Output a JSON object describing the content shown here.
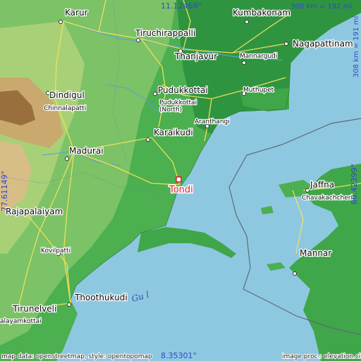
{
  "map": {
    "target_city": "Tondi",
    "cities": [
      {
        "id": "karur",
        "name": "Karur"
      },
      {
        "id": "kumbakonam",
        "name": "Kumbakonam"
      },
      {
        "id": "tiruchirappalli",
        "name": "Tiruchirappalli"
      },
      {
        "id": "thanjavur",
        "name": "Thanjavur"
      },
      {
        "id": "nagapattinam",
        "name": "Nagapattinam"
      },
      {
        "id": "mannargudi",
        "name": "Mannargudi"
      },
      {
        "id": "dindigul",
        "name": "Dindigul"
      },
      {
        "id": "chinnalapatti",
        "name": "Chinnalapatti"
      },
      {
        "id": "pudukkottai",
        "name": "Pudukkottai"
      },
      {
        "id": "pudukkottai-north",
        "name": "Pudukkottai\n(North)"
      },
      {
        "id": "muthupet",
        "name": "Muthupet"
      },
      {
        "id": "aranthangi",
        "name": "Aranthangi"
      },
      {
        "id": "karaikudi",
        "name": "Karaikudi"
      },
      {
        "id": "madurai",
        "name": "Madurai"
      },
      {
        "id": "jaffna",
        "name": "Jaffna"
      },
      {
        "id": "chavakachcheri",
        "name": "Chavakachcheri"
      },
      {
        "id": "rajapalaiyam",
        "name": "Rajapalaiyam"
      },
      {
        "id": "kovilpatti",
        "name": "Kovilpatti"
      },
      {
        "id": "mannar",
        "name": "Mannar"
      },
      {
        "id": "thoothukudi",
        "name": "Thoothukudi"
      },
      {
        "id": "tirunelveli",
        "name": "Tirunelveli"
      },
      {
        "id": "palayamkottai",
        "name": "alayamkottai"
      }
    ],
    "coords": {
      "north": "11.12469°",
      "south": "8.35301°",
      "west": "77.61149°",
      "east": "80.42399°"
    },
    "scale": {
      "horizontal": "308 km = 192 mi",
      "vertical": "308 km = 191 mi"
    },
    "water_label": "Gu l",
    "credits": {
      "left": "map data: openstreetmap, style: opentopomap",
      "right": "image proc.: elevation.city"
    },
    "colors": {
      "sea": "#8ec8e0",
      "lowland": "#3fa64a",
      "green_mid": "#66b858",
      "upland": "#b7d47a",
      "hills": "#c8a56a",
      "target": "#e0202a",
      "coord_text": "#3348cc"
    }
  }
}
